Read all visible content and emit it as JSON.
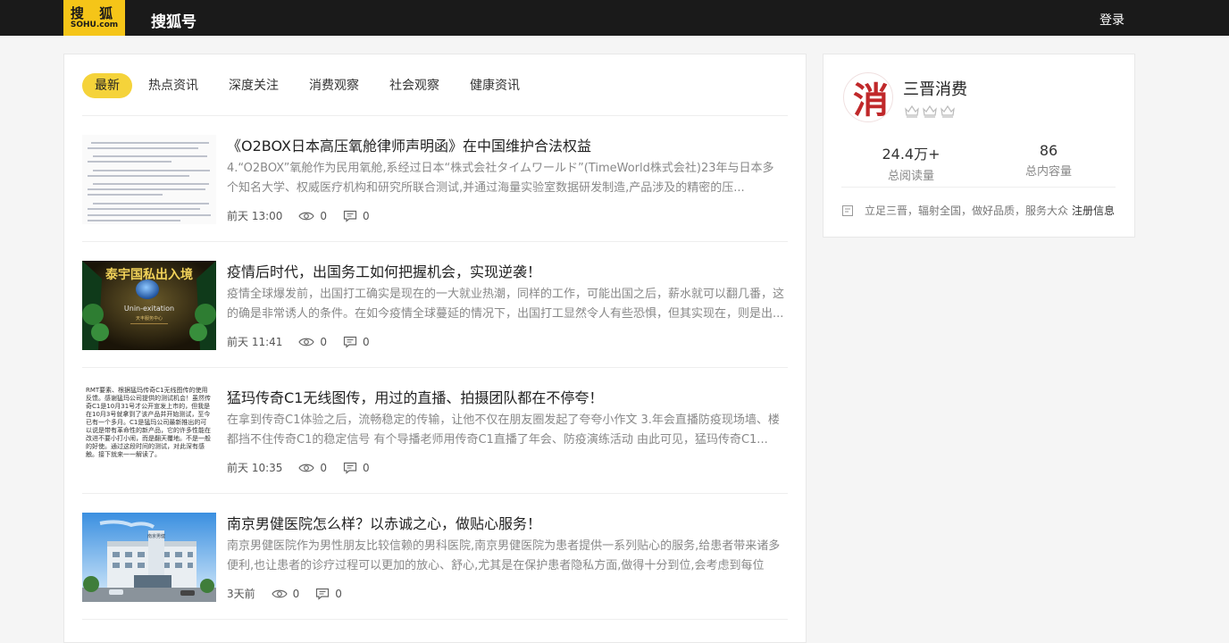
{
  "header": {
    "logo_cn": "搜 狐",
    "logo_en": "SOHU.com",
    "brand": "搜狐号",
    "login": "登录"
  },
  "tabs": [
    {
      "label": "最新",
      "active": true
    },
    {
      "label": "热点资讯",
      "active": false
    },
    {
      "label": "深度关注",
      "active": false
    },
    {
      "label": "消费观察",
      "active": false
    },
    {
      "label": "社会观察",
      "active": false
    },
    {
      "label": "健康资讯",
      "active": false
    }
  ],
  "articles": [
    {
      "title": "《O2BOX日本高压氧舱律师声明函》在中国维护合法权益",
      "desc": "4.“O2BOX”氧舱作为民用氧舱,系经过日本“株式会社タイムワールド”(TimeWorld株式会社)23年与日本多个知名大学、权威医疗机构和研究所联合测试,并通过海量实验室数据研发制造,产品涉及的精密的压...",
      "time": "前天 13:00",
      "views": "0",
      "comments": "0"
    },
    {
      "title": "疫情后时代，出国务工如何把握机会，实现逆袭！",
      "desc": "疫情全球爆发前，出国打工确实是现在的一大就业热潮，同样的工作，可能出国之后，薪水就可以翻几番，这的确是非常诱人的条件。在如今疫情全球蔓延的情况下，出国打工显然令人有些恐惧，但其实现在，则是出...",
      "time": "前天 11:41",
      "views": "0",
      "comments": "0"
    },
    {
      "title": "猛玛传奇C1无线图传，用过的直播、拍摄团队都在不停夸！",
      "desc": "在拿到传奇C1体验之后，流畅稳定的传输，让他不仅在朋友圈发起了夸夸小作文 3.年会直播防疫现场墙、楼都挡不住传奇C1的稳定信号 有个导播老师用传奇C1直播了年会、防疫演练活动 由此可见，猛玛传奇C1...",
      "time": "前天 10:35",
      "views": "0",
      "comments": "0"
    },
    {
      "title": "南京男健医院怎么样？以赤诚之心，做贴心服务！",
      "desc": "南京男健医院作为男性朋友比较信赖的男科医院,南京男健医院为患者提供一系列贴心的服务,给患者带来诸多便利,也让患者的诊疗过程可以更加的放心、舒心,尤其是在保护患者隐私方面,做得十分到位,会考虑到每位患...",
      "time": "3天前",
      "views": "0",
      "comments": "0"
    }
  ],
  "thumb2_text": "Unin-exitation",
  "thumb3_text": "RMT要素、根据猛玛传奇C1无线图传的使用反馈。感谢猛玛公司提供的测试机会！虽然传奇C1是10月31号才公开宣发上市的，但我是在10月3号就拿到了该产品并开始测试，至今已有一个多月。C1是猛玛公司最新推出的可以说是带有革命性的新产品，它的许多性能在改进不要小打小闹，而是翻天覆地。不是一般的好使。通过这段时间的测试，对此深有感触。接下就来一一解读了。",
  "profile": {
    "avatar_char": "消",
    "name": "三晋消费",
    "reads_value": "24.4万+",
    "reads_label": "总阅读量",
    "content_value": "86",
    "content_label": "总内容量",
    "intro": "立足三晋，辐射全国，做好品质，服务大众",
    "register_link": "注册信息"
  }
}
